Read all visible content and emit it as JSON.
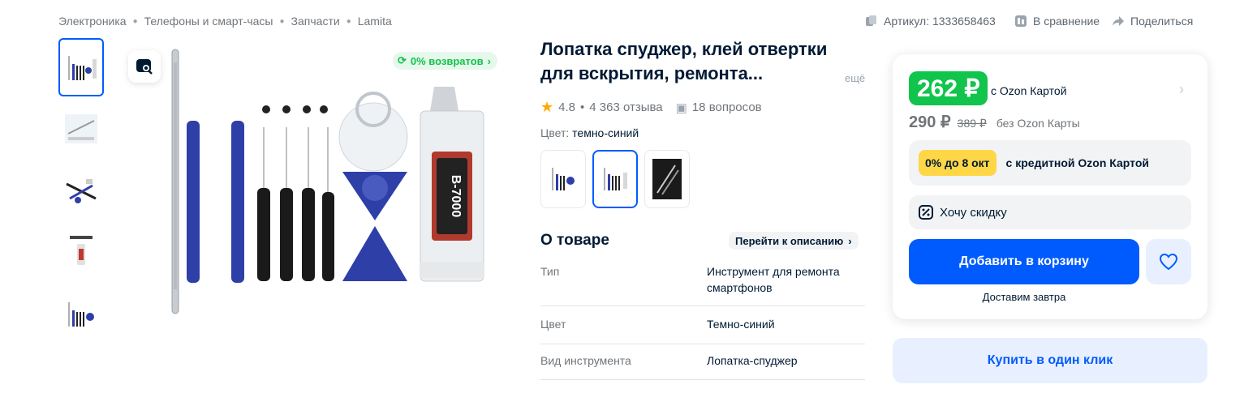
{
  "breadcrumbs": [
    "Электроника",
    "Телефоны и смарт-часы",
    "Запчасти",
    "Lamita"
  ],
  "top_actions": {
    "article": "Артикул: 1333658463",
    "compare": "В сравнение",
    "share": "Поделиться"
  },
  "gallery": {
    "returns_badge": "0% возвратов",
    "thumbnail_count": 5
  },
  "product": {
    "title": "Лопатка спуджер, клей отвертки для вскрытия, ремонта...",
    "more": "ещё",
    "rating": "4.8",
    "reviews": "4 363 отзыва",
    "questions": "18 вопросов",
    "color_label": "Цвет:",
    "color_value": "темно-синий"
  },
  "about": {
    "heading": "О товаре",
    "goto_desc": "Перейти к описанию",
    "specs": [
      {
        "key": "Тип",
        "value": "Инструмент для ремонта смартфонов"
      },
      {
        "key": "Цвет",
        "value": "Темно-синий"
      },
      {
        "key": "Вид инструмента",
        "value": "Лопатка-спуджер"
      }
    ]
  },
  "buy": {
    "price_card": "262 ₽",
    "with_card": "с Ozon Картой",
    "price": "290 ₽",
    "old_price": "389 ₽",
    "without_card": "без Ozon Карты",
    "credit_pill": "0% до 8 окт",
    "credit_text": "с кредитной Ozon Картой",
    "want_discount": "Хочу скидку",
    "add_to_cart": "Добавить в корзину",
    "delivery": "Доставим завтра",
    "one_click": "Купить в один клик"
  },
  "colors": {
    "accent": "#005bff",
    "green": "#10c44c",
    "yellow": "#ffd645",
    "tool_blue": "#2e3fa8"
  }
}
